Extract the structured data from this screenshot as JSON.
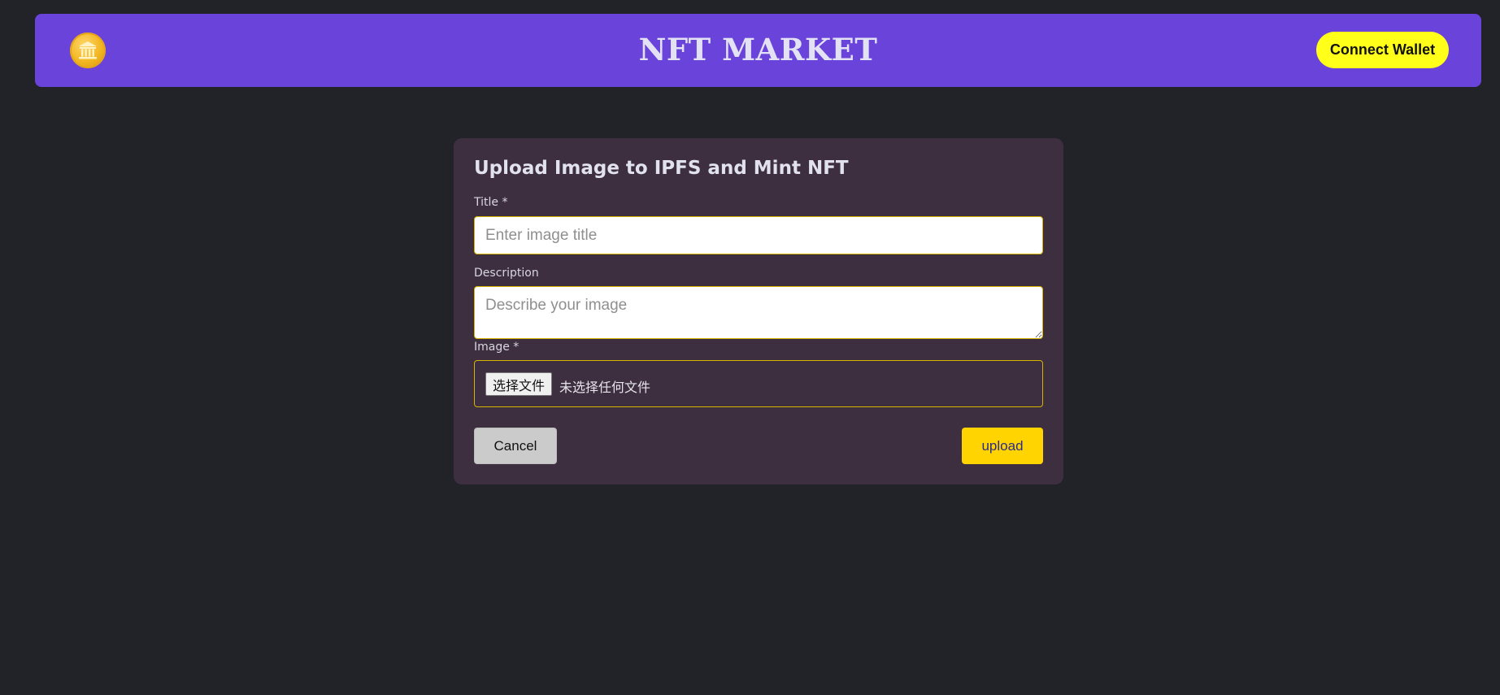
{
  "header": {
    "logo_icon": "coin-bank-icon",
    "title": "NFT MARKET",
    "connect_label": "Connect Wallet"
  },
  "form": {
    "heading": "Upload Image to IPFS and Mint NFT",
    "title_label": "Title *",
    "title_placeholder": "Enter image title",
    "title_value": "",
    "description_label": "Description",
    "description_placeholder": "Describe your image",
    "description_value": "",
    "image_label": "Image *",
    "file_button_label": "选择文件",
    "file_status": "未选择任何文件",
    "cancel_label": "Cancel",
    "upload_label": "upload"
  },
  "colors": {
    "page_bg": "#212328",
    "header_bg": "#6a43da",
    "card_bg": "#3d2f3f",
    "accent_yellow": "#ffd400",
    "connect_button": "#ffff1a"
  }
}
